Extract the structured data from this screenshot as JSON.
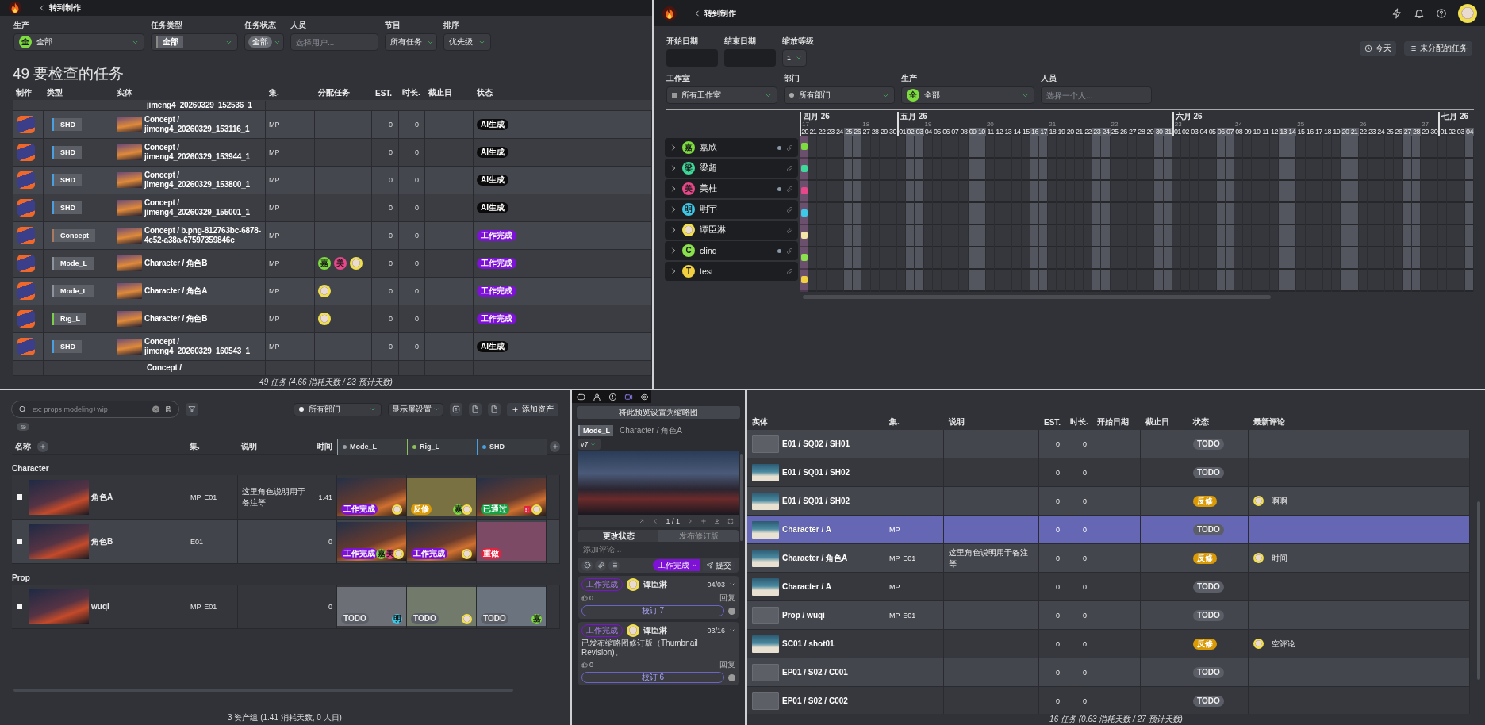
{
  "task_review": {
    "back": "转到制作",
    "filters": [
      {
        "kind": "avatar",
        "label": "生产",
        "avatar": {
          "kind": "letter",
          "initial": "全",
          "color": "#7ddc3e"
        },
        "value": "全部"
      },
      {
        "kind": "tag",
        "label": "任务类型",
        "value": "全部"
      },
      {
        "kind": "chip",
        "label": "任务状态",
        "value": "全部"
      },
      {
        "kind": "search",
        "label": "人员",
        "placeholder": "选择用户..."
      },
      {
        "kind": "select",
        "label": "节目",
        "value": "所有任务"
      },
      {
        "kind": "select",
        "label": "排序",
        "value": "优先级"
      }
    ],
    "title": "49 要检查的任务",
    "columns": [
      "制作",
      "类型",
      "实体",
      "集.",
      "分配任务",
      "EST.",
      "时长.",
      "截止日",
      "状态"
    ],
    "rows": [
      {
        "kind": "partial_top",
        "entity": "jimeng4_20260329_152536_1"
      },
      {
        "kind": "full",
        "type": "SHD",
        "color": "#4a9fe0",
        "entity": "Concept / jimeng4_20260329_153116_1",
        "episode": "MP",
        "est": "0",
        "duration": "0",
        "status": {
          "label": "AI生成",
          "kind": "ai"
        }
      },
      {
        "kind": "full",
        "type": "SHD",
        "color": "#4a9fe0",
        "entity": "Concept / jimeng4_20260329_153944_1",
        "episode": "MP",
        "est": "0",
        "duration": "0",
        "status": {
          "label": "AI生成",
          "kind": "ai"
        }
      },
      {
        "kind": "full",
        "type": "SHD",
        "color": "#4a9fe0",
        "entity": "Concept / jimeng4_20260329_153800_1",
        "episode": "MP",
        "est": "0",
        "duration": "0",
        "status": {
          "label": "AI生成",
          "kind": "ai"
        }
      },
      {
        "kind": "full",
        "type": "SHD",
        "color": "#4a9fe0",
        "entity": "Concept / jimeng4_20260329_155001_1",
        "episode": "MP",
        "est": "0",
        "duration": "0",
        "status": {
          "label": "AI生成",
          "kind": "ai"
        }
      },
      {
        "kind": "full",
        "type": "Concept",
        "color": "#a87a62",
        "entity": "Concept / b.png-812763bc-6878-4c52-a38a-67597359846c",
        "episode": "MP",
        "est": "0",
        "duration": "0",
        "status": {
          "label": "工作完成",
          "kind": "done"
        }
      },
      {
        "kind": "full",
        "type": "Mode_L",
        "color": "#8d939c",
        "entity": "Character / 角色B",
        "episode": "MP",
        "assignees": [
          {
            "kind": "letter",
            "initial": "嘉",
            "color": "#7ddc3e"
          },
          {
            "kind": "letter",
            "initial": "美",
            "color": "#e8488a"
          },
          {
            "kind": "photo"
          }
        ],
        "est": "0",
        "duration": "0",
        "status": {
          "label": "工作完成",
          "kind": "done"
        }
      },
      {
        "kind": "full",
        "type": "Mode_L",
        "color": "#8d939c",
        "entity": "Character / 角色A",
        "episode": "MP",
        "assignees": [
          {
            "kind": "photo"
          }
        ],
        "est": "0",
        "duration": "0",
        "status": {
          "label": "工作完成",
          "kind": "done"
        }
      },
      {
        "kind": "full",
        "type": "Rig_L",
        "color": "#7ccf4a",
        "entity": "Character / 角色B",
        "episode": "MP",
        "assignees": [
          {
            "kind": "photo"
          }
        ],
        "est": "0",
        "duration": "0",
        "status": {
          "label": "工作完成",
          "kind": "done"
        }
      },
      {
        "kind": "full",
        "type": "SHD",
        "color": "#4a9fe0",
        "entity": "Concept / jimeng4_20260329_160543_1",
        "episode": "MP",
        "est": "0",
        "duration": "0",
        "status": {
          "label": "AI生成",
          "kind": "ai"
        }
      },
      {
        "kind": "partial_bottom",
        "entity": "Concept /"
      }
    ],
    "footer": "49 任务 (4.66 消耗天数 / 23 预计天数)"
  },
  "schedule": {
    "back": "转到制作",
    "user_avatar": {
      "kind": "photo"
    },
    "start_label": "开始日期",
    "end_label": "结束日期",
    "zoom_label": "缩放等级",
    "zoom_value": "1",
    "today_button": "今天",
    "unassigned_button": "未分配的任务",
    "filters": [
      {
        "kind": "square",
        "label": "工作室",
        "value": "所有工作室"
      },
      {
        "kind": "dot",
        "label": "部门",
        "value": "所有部门"
      },
      {
        "kind": "avatar",
        "label": "生产",
        "avatar": {
          "kind": "letter",
          "initial": "全",
          "color": "#7ddc3e"
        },
        "value": "全部"
      },
      {
        "kind": "search",
        "label": "人员",
        "placeholder": "选择一个人..."
      }
    ],
    "months": [
      {
        "label": "四月 26",
        "days": [
          {
            "day": "20",
            "week": "17",
            "weekend": false,
            "today": true
          },
          {
            "day": "21",
            "weekend": false,
            "today": false
          },
          {
            "day": "22",
            "weekend": false,
            "today": false
          },
          {
            "day": "23",
            "weekend": false,
            "today": false
          },
          {
            "day": "24",
            "weekend": false,
            "today": false
          },
          {
            "day": "25",
            "weekend": true,
            "today": false
          },
          {
            "day": "26",
            "weekend": true,
            "today": false
          },
          {
            "day": "27",
            "week": "18",
            "weekend": false,
            "today": false
          },
          {
            "day": "28",
            "weekend": false,
            "today": false
          },
          {
            "day": "29",
            "weekend": false,
            "today": false
          },
          {
            "day": "30",
            "weekend": false,
            "today": false
          }
        ]
      },
      {
        "label": "五月 26",
        "days": [
          {
            "day": "01",
            "weekend": false,
            "today": false
          },
          {
            "day": "02",
            "weekend": true,
            "today": false
          },
          {
            "day": "03",
            "weekend": true,
            "today": false
          },
          {
            "day": "04",
            "week": "19",
            "weekend": false,
            "today": false
          },
          {
            "day": "05",
            "weekend": false,
            "today": false
          },
          {
            "day": "06",
            "weekend": false,
            "today": false
          },
          {
            "day": "07",
            "weekend": false,
            "today": false
          },
          {
            "day": "08",
            "weekend": false,
            "today": false
          },
          {
            "day": "09",
            "weekend": true,
            "today": false
          },
          {
            "day": "10",
            "weekend": true,
            "today": false
          },
          {
            "day": "11",
            "week": "20",
            "weekend": false,
            "today": false
          },
          {
            "day": "12",
            "weekend": false,
            "today": false
          },
          {
            "day": "13",
            "weekend": false,
            "today": false
          },
          {
            "day": "14",
            "weekend": false,
            "today": false
          },
          {
            "day": "15",
            "weekend": false,
            "today": false
          },
          {
            "day": "16",
            "weekend": true,
            "today": false
          },
          {
            "day": "17",
            "weekend": true,
            "today": false
          },
          {
            "day": "18",
            "week": "21",
            "weekend": false,
            "today": false
          },
          {
            "day": "19",
            "weekend": false,
            "today": false
          },
          {
            "day": "20",
            "weekend": false,
            "today": false
          },
          {
            "day": "21",
            "weekend": false,
            "today": false
          },
          {
            "day": "22",
            "weekend": false,
            "today": false
          },
          {
            "day": "23",
            "weekend": true,
            "today": false
          },
          {
            "day": "24",
            "weekend": true,
            "today": false
          },
          {
            "day": "25",
            "week": "22",
            "weekend": false,
            "today": false
          },
          {
            "day": "26",
            "weekend": false,
            "today": false
          },
          {
            "day": "27",
            "weekend": false,
            "today": false
          },
          {
            "day": "28",
            "weekend": false,
            "today": false
          },
          {
            "day": "29",
            "weekend": false,
            "today": false
          },
          {
            "day": "30",
            "weekend": true,
            "today": false
          },
          {
            "day": "31",
            "weekend": true,
            "today": false
          }
        ]
      },
      {
        "label": "六月 26",
        "days": [
          {
            "day": "01",
            "week": "23",
            "weekend": false,
            "today": false
          },
          {
            "day": "02",
            "weekend": false,
            "today": false
          },
          {
            "day": "03",
            "weekend": false,
            "today": false
          },
          {
            "day": "04",
            "weekend": false,
            "today": false
          },
          {
            "day": "05",
            "weekend": false,
            "today": false
          },
          {
            "day": "06",
            "weekend": true,
            "today": false
          },
          {
            "day": "07",
            "weekend": true,
            "today": false
          },
          {
            "day": "08",
            "week": "24",
            "weekend": false,
            "today": false
          },
          {
            "day": "09",
            "weekend": false,
            "today": false
          },
          {
            "day": "10",
            "weekend": false,
            "today": false
          },
          {
            "day": "11",
            "weekend": false,
            "today": false
          },
          {
            "day": "12",
            "weekend": false,
            "today": false
          },
          {
            "day": "13",
            "weekend": true,
            "today": false
          },
          {
            "day": "14",
            "weekend": true,
            "today": false
          },
          {
            "day": "15",
            "week": "25",
            "weekend": false,
            "today": false
          },
          {
            "day": "16",
            "weekend": false,
            "today": false
          },
          {
            "day": "17",
            "weekend": false,
            "today": false
          },
          {
            "day": "18",
            "weekend": false,
            "today": false
          },
          {
            "day": "19",
            "weekend": false,
            "today": false
          },
          {
            "day": "20",
            "weekend": true,
            "today": false
          },
          {
            "day": "21",
            "weekend": true,
            "today": false
          },
          {
            "day": "22",
            "week": "26",
            "weekend": false,
            "today": false
          },
          {
            "day": "23",
            "weekend": false,
            "today": false
          },
          {
            "day": "24",
            "weekend": false,
            "today": false
          },
          {
            "day": "25",
            "weekend": false,
            "today": false
          },
          {
            "day": "26",
            "weekend": false,
            "today": false
          },
          {
            "day": "27",
            "weekend": true,
            "today": false
          },
          {
            "day": "28",
            "weekend": true,
            "today": false
          },
          {
            "day": "29",
            "week": "27",
            "weekend": false,
            "today": false
          },
          {
            "day": "30",
            "weekend": false,
            "today": false
          }
        ]
      },
      {
        "label": "七月 26",
        "days": [
          {
            "day": "01",
            "weekend": false,
            "today": false
          },
          {
            "day": "02",
            "weekend": false,
            "today": false
          },
          {
            "day": "03",
            "weekend": false,
            "today": false
          },
          {
            "day": "04",
            "weekend": true,
            "today": false
          }
        ]
      }
    ],
    "people": [
      {
        "kind": "letter",
        "initial": "嘉",
        "name": "嘉欣",
        "color": "#7ddc3e",
        "online": true,
        "briefcase": false
      },
      {
        "kind": "letter",
        "initial": "梁",
        "name": "梁超",
        "color": "#3ed89a",
        "online": false,
        "briefcase": false
      },
      {
        "kind": "letter",
        "initial": "美",
        "name": "美桂",
        "color": "#e8488a",
        "online": true,
        "briefcase": false
      },
      {
        "kind": "letter",
        "initial": "明",
        "name": "明宇",
        "color": "#3ec8e8",
        "online": false,
        "briefcase": false
      },
      {
        "kind": "photo",
        "name": "谭臣淋",
        "color": "#f3e6a6",
        "online": false,
        "briefcase": true
      },
      {
        "kind": "letter",
        "initial": "C",
        "name": "clinq",
        "color": "#8be04e",
        "online": true,
        "briefcase": false
      },
      {
        "kind": "letter",
        "initial": "T",
        "name": "test",
        "color": "#f0d040",
        "online": false,
        "briefcase": false
      }
    ]
  },
  "assets": {
    "search_placeholder": "ex: props modeling+wip",
    "department": "所有部门",
    "display_settings": "显示屏设置",
    "add_button": "添加资产",
    "columns": [
      "名称",
      "集.",
      "说明",
      "时间"
    ],
    "task_types": [
      {
        "label": "Mode_L",
        "color": "#9aa0a8"
      },
      {
        "label": "Rig_L",
        "color": "#8fbf5a"
      },
      {
        "label": "SHD",
        "color": "#4a9fe0"
      }
    ],
    "groups": [
      {
        "name": "Character",
        "assets": [
          {
            "name": "角色A",
            "episodes": "MP, E01",
            "description": "这里角色说明用于备注等",
            "time": "1.41",
            "selected": false,
            "checked": false,
            "tasks": [
              {
                "kind": "photo",
                "status": {
                  "label": "工作完成",
                  "kind": "done"
                },
                "assignees": [
                  {
                    "kind": "photo"
                  }
                ]
              },
              {
                "kind": "color",
                "color": "#7a7142",
                "status": {
                  "label": "反修",
                  "kind": "retake"
                },
                "assignees": [
                  {
                    "kind": "letter",
                    "initial": "嘉",
                    "color": "#7ddc3e"
                  },
                  {
                    "kind": "photo"
                  }
                ]
              },
              {
                "kind": "photo",
                "status": {
                  "label": "已通过",
                  "kind": "approved"
                },
                "flag": "!!",
                "assignees": [
                  {
                    "kind": "photo"
                  }
                ]
              }
            ]
          },
          {
            "name": "角色B",
            "episodes": "E01",
            "time": "0",
            "selected": true,
            "checked": false,
            "tasks": [
              {
                "kind": "photo",
                "status": {
                  "label": "工作完成",
                  "kind": "done"
                },
                "assignees": [
                  {
                    "kind": "letter",
                    "initial": "嘉",
                    "color": "#7ddc3e"
                  },
                  {
                    "kind": "letter",
                    "initial": "美",
                    "color": "#e8488a"
                  },
                  {
                    "kind": "photo"
                  }
                ]
              },
              {
                "kind": "photo",
                "status": {
                  "label": "工作完成",
                  "kind": "done"
                },
                "assignees": [
                  {
                    "kind": "photo"
                  }
                ]
              },
              {
                "kind": "color",
                "color": "#7c4a64",
                "status": {
                  "label": "重做",
                  "kind": "redo"
                }
              }
            ]
          }
        ]
      },
      {
        "name": "Prop",
        "assets": [
          {
            "name": "wuqi",
            "episodes": "MP, E01",
            "time": "0",
            "selected": false,
            "checked": false,
            "tasks": [
              {
                "kind": "color",
                "color": "#6c6f75",
                "status": {
                  "label": "TODO",
                  "kind": "todo"
                },
                "assignees": [
                  {
                    "kind": "letter",
                    "initial": "明",
                    "color": "#3ec8e8"
                  }
                ]
              },
              {
                "kind": "color",
                "color": "#727a6c",
                "status": {
                  "label": "TODO",
                  "kind": "todo"
                },
                "assignees": [
                  {
                    "kind": "photo"
                  }
                ]
              },
              {
                "kind": "color",
                "color": "#6b747e",
                "status": {
                  "label": "TODO",
                  "kind": "todo"
                },
                "assignees": [
                  {
                    "kind": "letter",
                    "initial": "嘉",
                    "color": "#7ddc3e"
                  }
                ]
              }
            ]
          }
        ]
      }
    ],
    "footer": "3 资产组 (1.41 消耗天数, 0 人日)"
  },
  "review_panel": {
    "toolbar": [
      {
        "selected": false
      },
      {
        "selected": false
      },
      {
        "selected": false
      },
      {
        "selected": true
      },
      {
        "selected": false
      }
    ],
    "thumbnail_button": "将此预览设置为缩略图",
    "task_type": "Mode_L",
    "entity": "Character / 角色A",
    "version": "v7",
    "page": "1 / 1",
    "tabs": [
      {
        "label": "更改状态",
        "selected": true
      },
      {
        "label": "发布修订版",
        "selected": false
      }
    ],
    "comment_placeholder": "添加评论...",
    "status": {
      "label": "工作完成",
      "kind": "done"
    },
    "submit": "提交",
    "comments": [
      {
        "status": {
          "label": "工作完成",
          "kind": "done"
        },
        "author": {
          "kind": "photo"
        },
        "name": "谭臣淋",
        "date": "04/03",
        "likes": "0",
        "reply": "回复",
        "revision": "校订 7"
      },
      {
        "status": {
          "label": "工作完成",
          "kind": "done"
        },
        "author": {
          "kind": "photo"
        },
        "name": "谭臣淋",
        "date": "03/16",
        "text": "已发布缩略图修订版（Thumbnail Revision)。",
        "likes": "0",
        "reply": "回复",
        "revision": "校订 6"
      }
    ]
  },
  "task_list": {
    "columns": [
      "实体",
      "集.",
      "说明",
      "EST.",
      "时长.",
      "开始日期",
      "截止日",
      "状态",
      "最新评论"
    ],
    "rows": [
      {
        "thumbnail": {
          "kind": "empty"
        },
        "entity": "E01 / SQ02 / SH01",
        "est": "0",
        "duration": "0",
        "status": {
          "label": "TODO",
          "kind": "todo"
        },
        "selected": false
      },
      {
        "thumbnail": {
          "kind": "photo"
        },
        "entity": "E01 / SQ01 / SH02",
        "est": "0",
        "duration": "0",
        "status": {
          "label": "TODO",
          "kind": "todo"
        },
        "selected": false
      },
      {
        "thumbnail": {
          "kind": "photo"
        },
        "entity": "E01 / SQ01 / SH02",
        "est": "0",
        "duration": "0",
        "status": {
          "label": "反修",
          "kind": "retake"
        },
        "comment": {
          "author": {
            "kind": "photo"
          },
          "text": "啊啊"
        },
        "selected": false
      },
      {
        "thumbnail": {
          "kind": "photo"
        },
        "entity": "Character / A",
        "episodes": "MP",
        "est": "0",
        "duration": "0",
        "status": {
          "label": "TODO",
          "kind": "todo"
        },
        "selected": true
      },
      {
        "thumbnail": {
          "kind": "photo"
        },
        "entity": "Character / 角色A",
        "episodes": "MP, E01",
        "description": "这里角色说明用于备注等",
        "est": "0",
        "duration": "0",
        "status": {
          "label": "反修",
          "kind": "retake"
        },
        "comment": {
          "author": {
            "kind": "photo"
          },
          "text": "时间"
        },
        "selected": false
      },
      {
        "thumbnail": {
          "kind": "photo"
        },
        "entity": "Character / A",
        "episodes": "MP",
        "est": "0",
        "duration": "0",
        "status": {
          "label": "TODO",
          "kind": "todo"
        },
        "selected": false
      },
      {
        "thumbnail": {
          "kind": "empty"
        },
        "entity": "Prop / wuqi",
        "episodes": "MP, E01",
        "est": "0",
        "duration": "0",
        "status": {
          "label": "TODO",
          "kind": "todo"
        },
        "selected": false
      },
      {
        "thumbnail": {
          "kind": "photo"
        },
        "entity": "SC01 / shot01",
        "est": "0",
        "duration": "0",
        "status": {
          "label": "反修",
          "kind": "retake"
        },
        "comment": {
          "author": {
            "kind": "photo"
          },
          "text": "空评论"
        },
        "selected": false
      },
      {
        "thumbnail": {
          "kind": "empty"
        },
        "entity": "EP01 / S02 / C001",
        "est": "0",
        "duration": "0",
        "status": {
          "label": "TODO",
          "kind": "todo"
        },
        "selected": false
      },
      {
        "thumbnail": {
          "kind": "empty"
        },
        "entity": "EP01 / S02 / C002",
        "est": "0",
        "duration": "0",
        "status": {
          "label": "TODO",
          "kind": "todo"
        },
        "selected": false
      }
    ],
    "footer": "16 任务 (0.63 消耗天数 / 27 预计天数)"
  }
}
